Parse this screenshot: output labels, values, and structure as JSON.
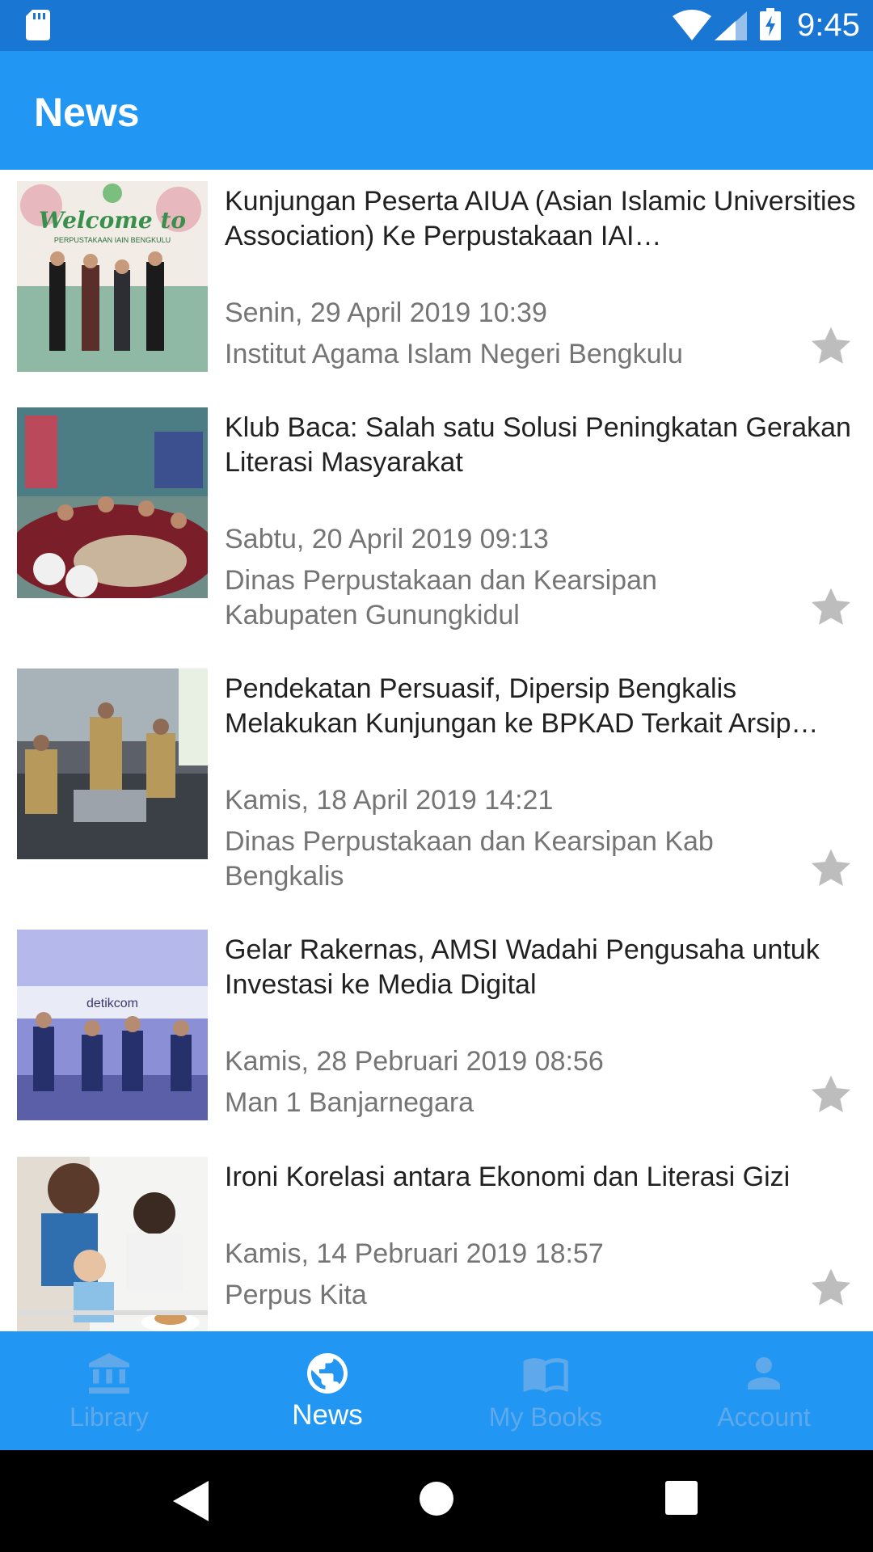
{
  "status_bar": {
    "time": "9:45",
    "icons": [
      "sd-card-icon",
      "wifi-icon",
      "signal-icon",
      "battery-charging-icon"
    ]
  },
  "app_bar": {
    "title": "News"
  },
  "news": [
    {
      "title": "Kunjungan Peserta AIUA (Asian Islamic Universities Association) Ke Perpustakaan IAI…",
      "date": "Senin, 29 April 2019 10:39",
      "source": "Institut Agama Islam Negeri Bengkulu",
      "thumb_text": "Welcome to",
      "thumb_subtext": "PERPUSTAKAAN IAIN BENGKULU"
    },
    {
      "title": "Klub Baca: Salah satu Solusi Peningkatan Gerakan Literasi Masyarakat",
      "date": "Sabtu, 20 April 2019 09:13",
      "source": "Dinas Perpustakaan dan Kearsipan Kabupaten Gunungkidul"
    },
    {
      "title": "Pendekatan Persuasif, Dipersip Bengkalis Melakukan Kunjungan ke BPKAD Terkait Arsip…",
      "date": "Kamis, 18 April 2019 14:21",
      "source": "Dinas Perpustakaan dan Kearsipan Kab Bengkalis"
    },
    {
      "title": "Gelar Rakernas, AMSI Wadahi Pengusaha untuk Investasi ke Media Digital",
      "date": "Kamis, 28 Pebruari 2019 08:56",
      "source": "Man 1 Banjarnegara",
      "thumb_text": "detikcom"
    },
    {
      "title": "Ironi Korelasi antara Ekonomi dan Literasi Gizi",
      "date": "Kamis, 14 Pebruari 2019 18:57",
      "source": "Perpus Kita"
    }
  ],
  "bottom_nav": [
    {
      "label": "Library",
      "icon": "library-icon",
      "active": false
    },
    {
      "label": "News",
      "icon": "globe-icon",
      "active": true
    },
    {
      "label": "My Books",
      "icon": "book-icon",
      "active": false
    },
    {
      "label": "Account",
      "icon": "account-icon",
      "active": false
    }
  ],
  "colors": {
    "status_bar": "#1976D2",
    "primary": "#2196F3",
    "title_text": "#212121",
    "secondary_text": "#757575",
    "inactive_nav": "#5fa9ea",
    "star": "#bdbdbd"
  }
}
